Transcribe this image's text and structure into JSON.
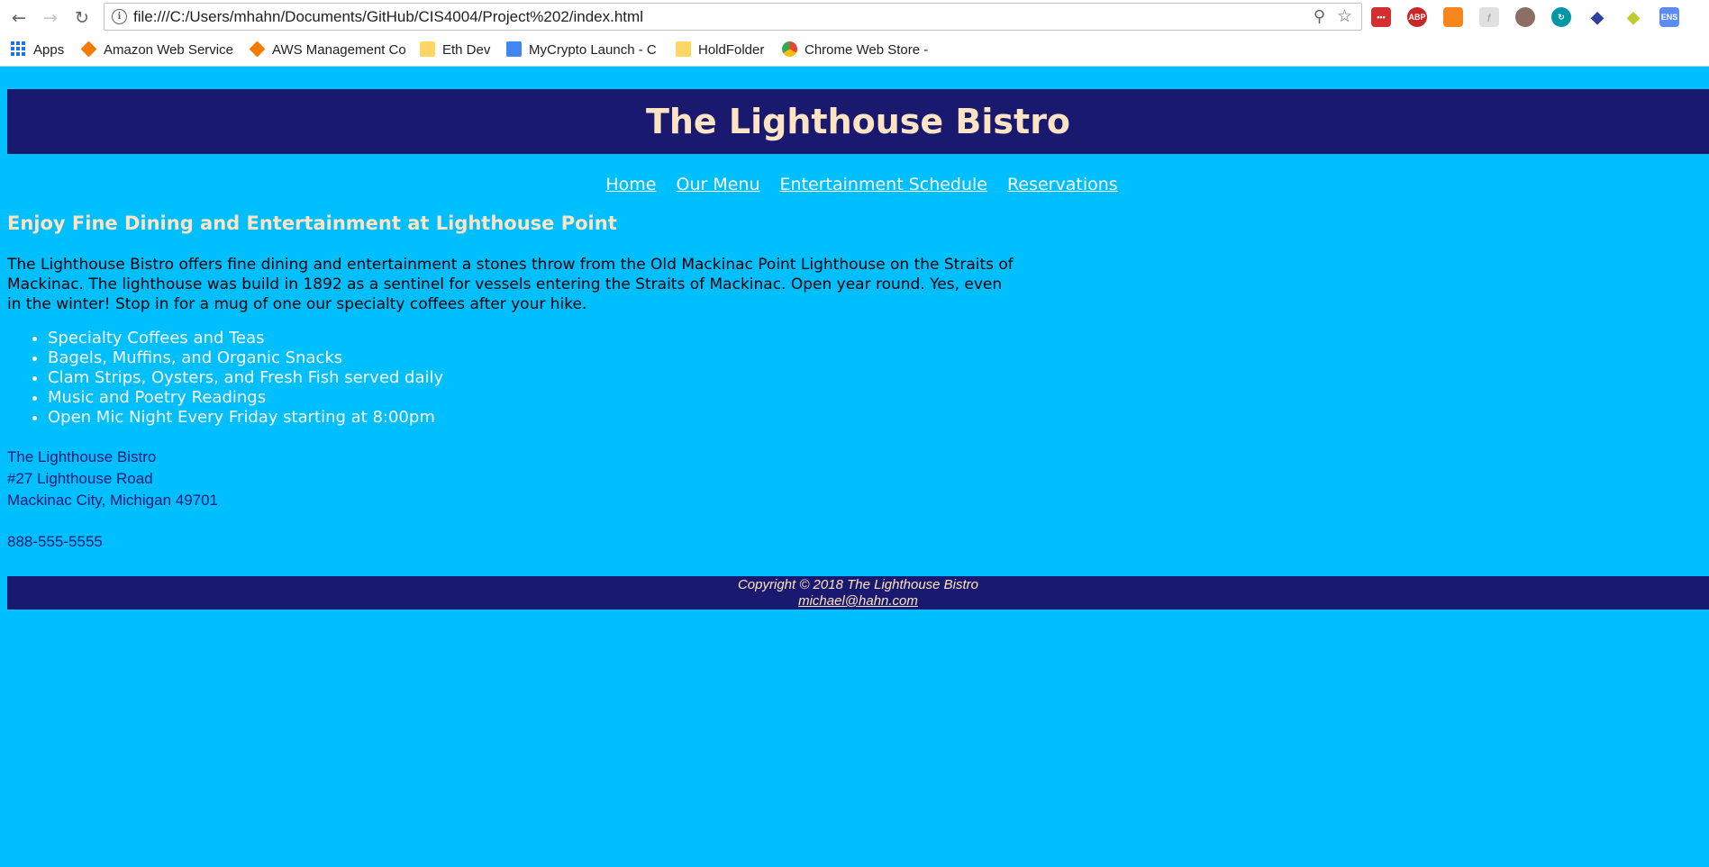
{
  "browser": {
    "url": "file:///C:/Users/mhahn/Documents/GitHub/CIS4004/Project%202/index.html",
    "bookmarks": [
      {
        "label": "Apps",
        "icon": "apps-grid-icon"
      },
      {
        "label": "Amazon Web Service",
        "icon": "aws-cube-icon"
      },
      {
        "label": "AWS Management Co",
        "icon": "aws-cube-icon"
      },
      {
        "label": "Eth Dev",
        "icon": "folder-icon"
      },
      {
        "label": "MyCrypto Launch - C",
        "icon": "doc-icon"
      },
      {
        "label": "HoldFolder",
        "icon": "folder-icon"
      },
      {
        "label": "Chrome Web Store -",
        "icon": "chrome-store-icon"
      }
    ],
    "extensions": [
      "lastpass-icon",
      "adblock-plus-icon",
      "metamask-fox-icon",
      "script-icon",
      "owl-icon",
      "refresh-ext-icon",
      "ethereum-icon",
      "tezos-icon",
      "ens-icon"
    ],
    "extension_labels": {
      "lastpass": "•••",
      "abp": "ABP",
      "ens": "ENS"
    }
  },
  "site": {
    "title": "The Lighthouse Bistro",
    "nav": [
      "Home",
      "Our Menu",
      "Entertainment Schedule",
      "Reservations"
    ],
    "tagline": "Enjoy Fine Dining and Entertainment at Lighthouse Point",
    "intro": "The Lighthouse Bistro offers fine dining and entertainment a stones throw from the Old Mackinac Point Lighthouse on the Straits of Mackinac. The lighthouse was build in 1892 as a sentinel for vessels entering the Straits of Mackinac. Open year round. Yes, even in the winter! Stop in for a mug of one our specialty coffees after your hike.",
    "features": [
      "Specialty Coffees and Teas",
      "Bagels, Muffins, and Organic Snacks",
      "Clam Strips, Oysters, and Fresh Fish served daily",
      "Music and Poetry Readings",
      "Open Mic Night Every Friday starting at 8:00pm"
    ],
    "address": {
      "name": "The Lighthouse Bistro",
      "street": "#27 Lighthouse Road",
      "city": "Mackinac City, Michigan 49701"
    },
    "phone": "888-555-5555",
    "footer": {
      "copyright": "Copyright © 2018 The Lighthouse Bistro",
      "email": "michael@hahn.com"
    }
  },
  "colors": {
    "page_bg": "#00bfff",
    "header_bg": "#191970",
    "title_text": "#ffe4c4",
    "nav_text": "#ffffff",
    "address_text": "#191970"
  }
}
